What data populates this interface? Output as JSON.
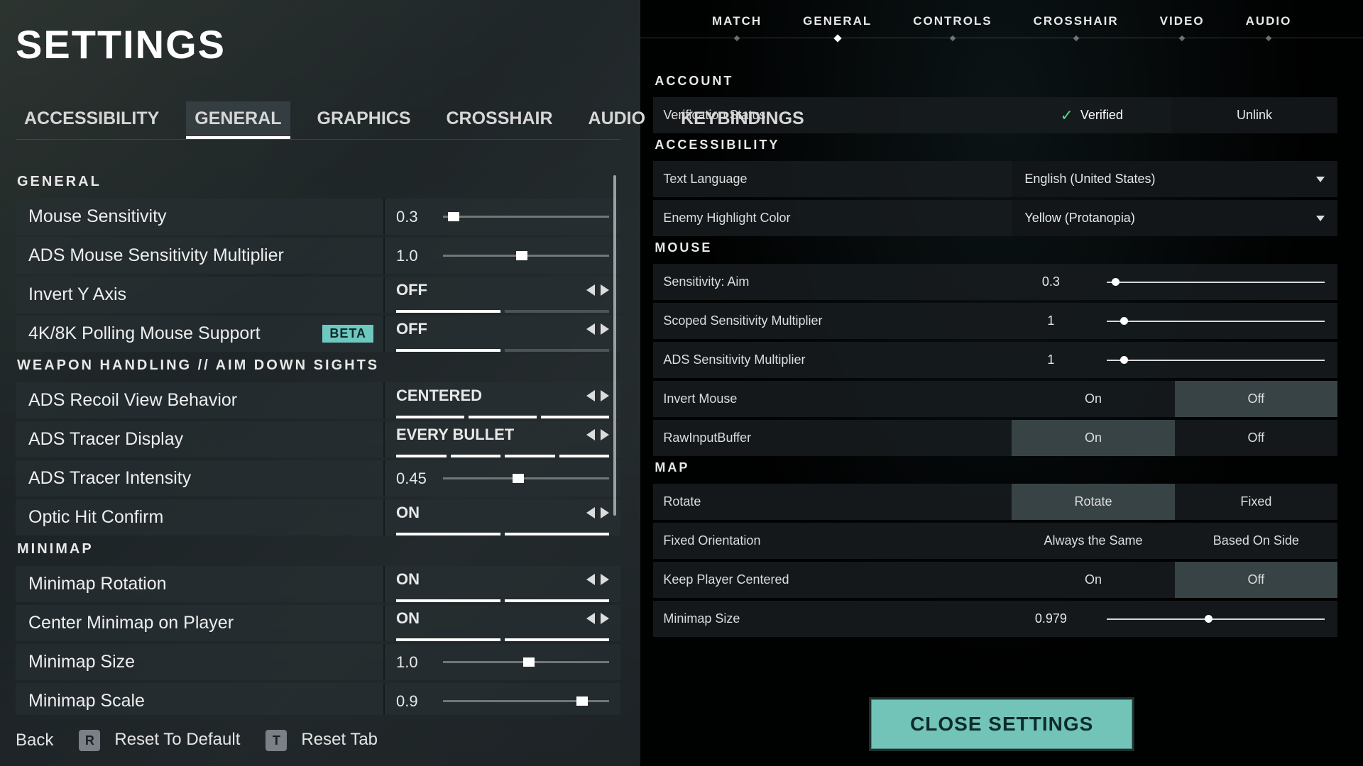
{
  "left": {
    "title": "SETTINGS",
    "tabs": [
      "ACCESSIBILITY",
      "GENERAL",
      "GRAPHICS",
      "CROSSHAIR",
      "AUDIO",
      "KEYBINDINGS"
    ],
    "active_tab": 1,
    "sections": [
      {
        "title": "GENERAL",
        "rows": [
          {
            "label": "Mouse Sensitivity",
            "type": "slider",
            "value": "0.3",
            "pct": 3
          },
          {
            "label": "ADS Mouse Sensitivity Multiplier",
            "type": "slider",
            "value": "1.0",
            "pct": 44
          },
          {
            "label": "Invert Y Axis",
            "type": "toggle",
            "value": "OFF",
            "segs": 2,
            "fill": 1
          },
          {
            "label": "4K/8K Polling Mouse Support",
            "badge": "BETA",
            "type": "toggle",
            "value": "OFF",
            "segs": 2,
            "fill": 1
          }
        ]
      },
      {
        "title": "WEAPON HANDLING // AIM DOWN SIGHTS",
        "rows": [
          {
            "label": "ADS Recoil View Behavior",
            "type": "toggle",
            "value": "CENTERED",
            "segs": 3,
            "fill": 3
          },
          {
            "label": "ADS Tracer Display",
            "type": "toggle",
            "value": "EVERY BULLET",
            "segs": 4,
            "fill": 4
          },
          {
            "label": "ADS Tracer Intensity",
            "type": "slider",
            "value": "0.45",
            "pct": 42
          },
          {
            "label": "Optic Hit Confirm",
            "type": "toggle",
            "value": "ON",
            "segs": 2,
            "fill": 2
          }
        ]
      },
      {
        "title": "MINIMAP",
        "rows": [
          {
            "label": "Minimap Rotation",
            "type": "toggle",
            "value": "ON",
            "segs": 2,
            "fill": 2
          },
          {
            "label": "Center Minimap on Player",
            "type": "toggle",
            "value": "ON",
            "segs": 2,
            "fill": 2
          },
          {
            "label": "Minimap Size",
            "type": "slider",
            "value": "1.0",
            "pct": 48
          },
          {
            "label": "Minimap Scale",
            "type": "slider",
            "value": "0.9",
            "pct": 80
          }
        ]
      }
    ],
    "footer": {
      "back": "Back",
      "reset_key": "R",
      "reset_label": "Reset To Default",
      "tab_key": "T",
      "tab_label": "Reset Tab"
    }
  },
  "right": {
    "tabs": [
      "MATCH",
      "GENERAL",
      "CONTROLS",
      "CROSSHAIR",
      "VIDEO",
      "AUDIO"
    ],
    "active_tab": 1,
    "sections": [
      {
        "title": "ACCOUNT",
        "rows": [
          {
            "label": "Verification Status",
            "type": "verify",
            "value": "Verified",
            "secondary": "Unlink"
          }
        ]
      },
      {
        "title": "ACCESSIBILITY",
        "rows": [
          {
            "label": "Text Language",
            "type": "dropdown",
            "value": "English (United States)"
          },
          {
            "label": "Enemy Highlight Color",
            "type": "dropdown",
            "value": "Yellow (Protanopia)"
          }
        ]
      },
      {
        "title": "MOUSE",
        "rows": [
          {
            "label": "Sensitivity: Aim",
            "type": "slider",
            "value": "0.3",
            "pct": 2
          },
          {
            "label": "Scoped Sensitivity Multiplier",
            "type": "slider",
            "value": "1",
            "pct": 6
          },
          {
            "label": "ADS Sensitivity Multiplier",
            "type": "slider",
            "value": "1",
            "pct": 6
          },
          {
            "label": "Invert Mouse",
            "type": "buttons",
            "options": [
              "On",
              "Off"
            ],
            "sel": 1
          },
          {
            "label": "RawInputBuffer",
            "type": "buttons",
            "options": [
              "On",
              "Off"
            ],
            "sel": 0
          }
        ]
      },
      {
        "title": "MAP",
        "rows": [
          {
            "label": "Rotate",
            "type": "buttons",
            "options": [
              "Rotate",
              "Fixed"
            ],
            "sel": 0
          },
          {
            "label": "Fixed Orientation",
            "type": "buttons",
            "options": [
              "Always the Same",
              "Based On Side"
            ],
            "sel": -1
          },
          {
            "label": "Keep Player Centered",
            "type": "buttons",
            "options": [
              "On",
              "Off"
            ],
            "sel": 1
          },
          {
            "label": "Minimap Size",
            "type": "slider",
            "value": "0.979",
            "pct": 45
          }
        ]
      }
    ],
    "close": "CLOSE SETTINGS"
  }
}
